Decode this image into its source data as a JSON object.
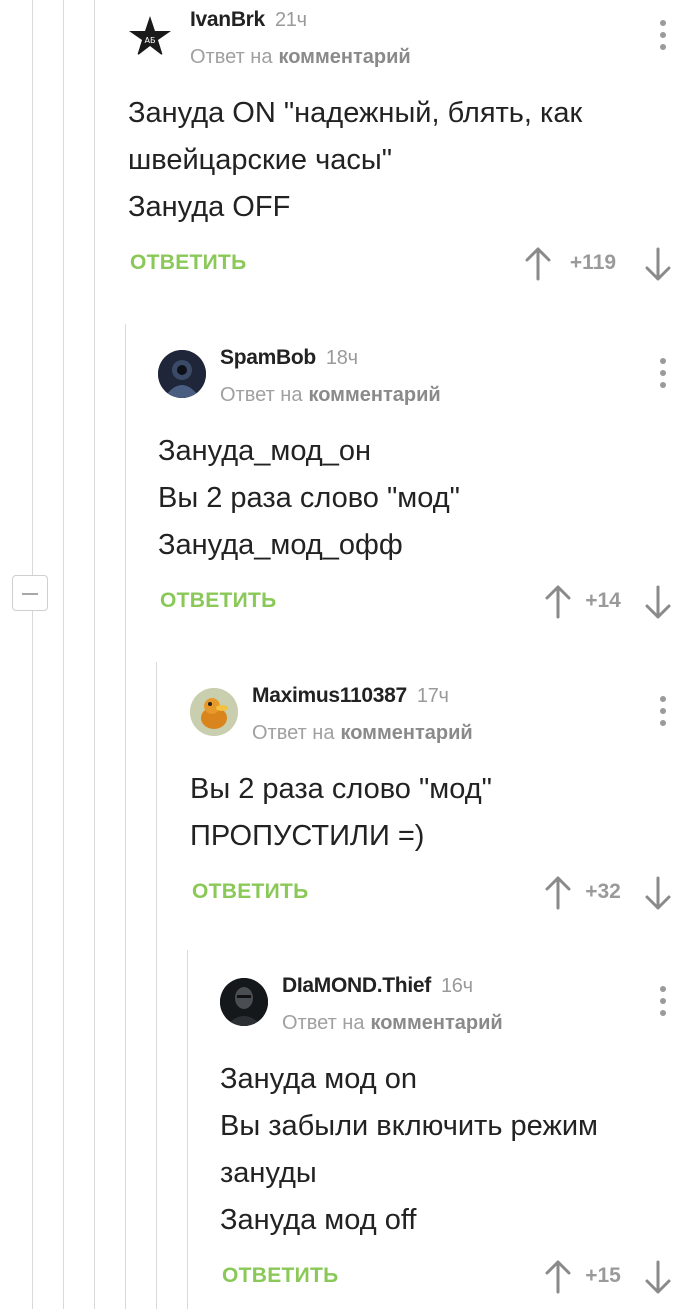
{
  "reply_prefix": "Ответ на",
  "reply_link": "комментарий",
  "reply_button": "ОТВЕТИТЬ",
  "comments": [
    {
      "author": "IvanBrk",
      "time": "21ч",
      "text": "Зануда ON \"надежный, блять, как швейцарские часы\"\nЗануда OFF",
      "score": "+119",
      "avatar_icon": "star-emblem-icon"
    },
    {
      "author": "SpamBob",
      "time": "18ч",
      "text": "Зануда_мод_он\nВы 2 раза слово \"мод\"\nЗануда_мод_офф",
      "score": "+14",
      "avatar_icon": "hooded-figure-icon"
    },
    {
      "author": "Maximus110387",
      "time": "17ч",
      "text": "Вы 2 раза слово \"мод\"\nПРОПУСТИЛИ =)",
      "score": "+32",
      "avatar_icon": "duck-character-icon"
    },
    {
      "author": "DIaMOND.Thief",
      "time": "16ч",
      "text": "Зануда мод on\nВы забыли включить режим зануды\nЗануда мод off",
      "score": "+15",
      "avatar_icon": "dark-portrait-icon"
    }
  ]
}
